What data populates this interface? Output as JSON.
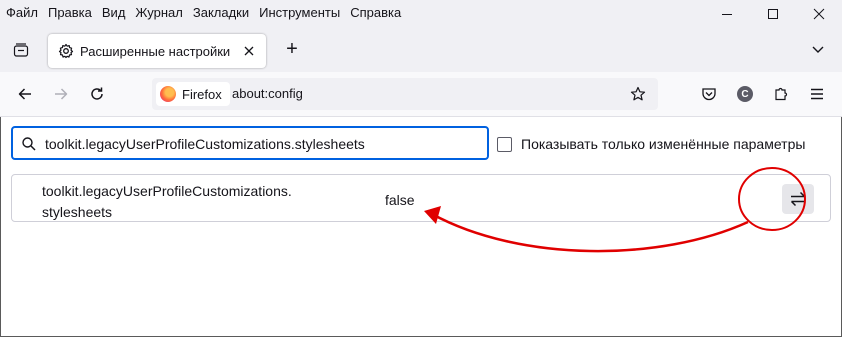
{
  "menubar": {
    "items": [
      "Файл",
      "Правка",
      "Вид",
      "Журнал",
      "Закладки",
      "Инструменты",
      "Справка"
    ]
  },
  "window_controls": {
    "minimize_icon": "minimize-icon",
    "maximize_icon": "maximize-icon",
    "close_icon": "close-icon"
  },
  "tab": {
    "title": "Расширенные настройки",
    "close_label": "✕",
    "icon": "gear-icon"
  },
  "newtab": {
    "label": "+"
  },
  "urlbar": {
    "identity_label": "Firefox",
    "url": "about:config"
  },
  "account": {
    "initial": "C"
  },
  "config": {
    "search_value": "toolkit.legacyUserProfileCustomizations.stylesheets",
    "show_modified_label": "Показывать только изменённые параметры",
    "pref": {
      "name_line1": "toolkit.legacyUserProfileCustomizations.",
      "name_line2": "stylesheets",
      "value": "false"
    }
  },
  "colors": {
    "accent": "#0061e0",
    "annotation": "#e00000"
  }
}
